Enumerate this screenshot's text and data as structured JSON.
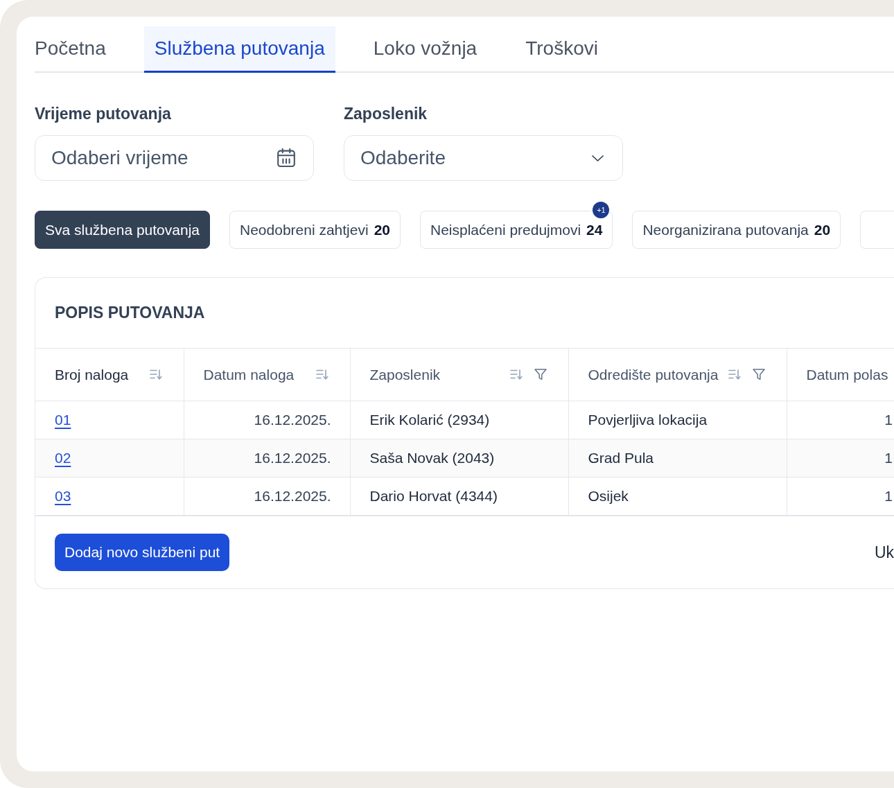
{
  "tabs": [
    {
      "label": "Početna",
      "selected": false
    },
    {
      "label": "Službena putovanja",
      "selected": true
    },
    {
      "label": "Loko vožnja",
      "selected": false
    },
    {
      "label": "Troškovi",
      "selected": false
    }
  ],
  "filters": [
    {
      "kind": "date",
      "label": "Vrijeme putovanja",
      "placeholder": "Odaberi vrijeme"
    },
    {
      "kind": "select",
      "label": "Zaposlenik",
      "placeholder": "Odaberite"
    }
  ],
  "quick_filters": [
    {
      "label": "Sva službena putovanja",
      "selected": true
    },
    {
      "label": "Neodobreni zahtjevi",
      "count": "20",
      "selected": false
    },
    {
      "label": "Neisplaćeni predujmovi",
      "count": "24",
      "badge": "+1",
      "selected": false
    },
    {
      "label": "Neorganizirana putovanja",
      "count": "20",
      "selected": false
    },
    {
      "selected": false
    }
  ],
  "table": {
    "title": "POPIS PUTOVANJA",
    "columns": [
      {
        "label": "Broj naloga",
        "kind": "link",
        "sortable": true,
        "filterable": false,
        "sorted": true
      },
      {
        "label": "Datum naloga",
        "kind": "date",
        "sortable": true,
        "filterable": false,
        "sorted": false
      },
      {
        "label": "Zaposlenik",
        "kind": "text",
        "sortable": true,
        "filterable": true,
        "sorted": false
      },
      {
        "label": "Odredište putovanja",
        "kind": "text",
        "sortable": true,
        "filterable": true,
        "sorted": false
      },
      {
        "label": "Datum polas",
        "kind": "date",
        "sorted": false
      }
    ],
    "rows": [
      [
        "01",
        "16.12.2025.",
        "Erik Kolarić (2934)",
        "Povjerljiva lokacija",
        "1"
      ],
      [
        "02",
        "16.12.2025.",
        "Saša Novak (2043)",
        "Grad Pula",
        "1"
      ],
      [
        "03",
        "16.12.2025.",
        "Dario Horvat (4344)",
        "Osijek",
        "1"
      ]
    ]
  },
  "footer": {
    "button": "Dodaj novo službeni put",
    "summary": "Uk"
  }
}
